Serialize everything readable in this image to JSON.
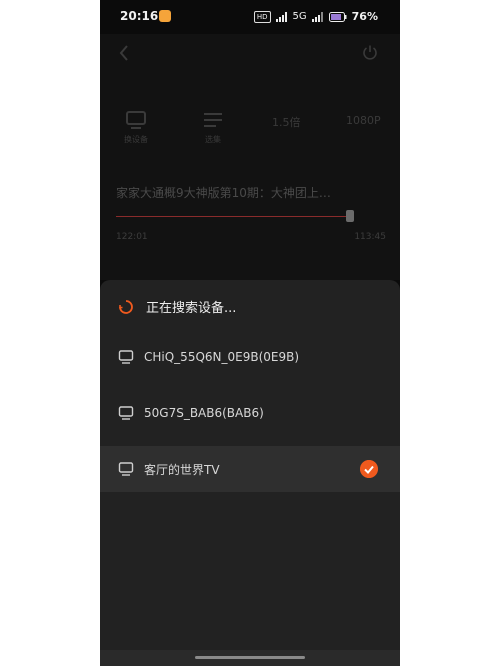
{
  "status_bar": {
    "time": "20:16",
    "hd_label": "HD",
    "signal1": "5G",
    "battery": "76%"
  },
  "player": {
    "controls": [
      {
        "icon": "tv-icon",
        "label": "换设备"
      },
      {
        "icon": "episodes-icon",
        "label": "选集"
      },
      {
        "icon": "speed-icon",
        "label": "1.5倍"
      },
      {
        "icon": "hd-icon",
        "label": "1080P"
      }
    ],
    "video_title": "家家大通概9大神版第10期：大神团上…",
    "current_time": "122:01",
    "total_time": "113:45",
    "progress_fraction": 0.99
  },
  "sheet": {
    "searching_text": "正在搜索设备...",
    "devices": [
      {
        "name": "CHiQ_55Q6N_0E9B(0E9B)",
        "selected": false
      },
      {
        "name": "50G7S_BAB6(BAB6)",
        "selected": false
      },
      {
        "name": "客厅的世界TV",
        "selected": true
      }
    ]
  },
  "colors": {
    "accent": "#f05a1e",
    "sheet_bg": "#222222",
    "selected_row": "#2f2f2f"
  }
}
